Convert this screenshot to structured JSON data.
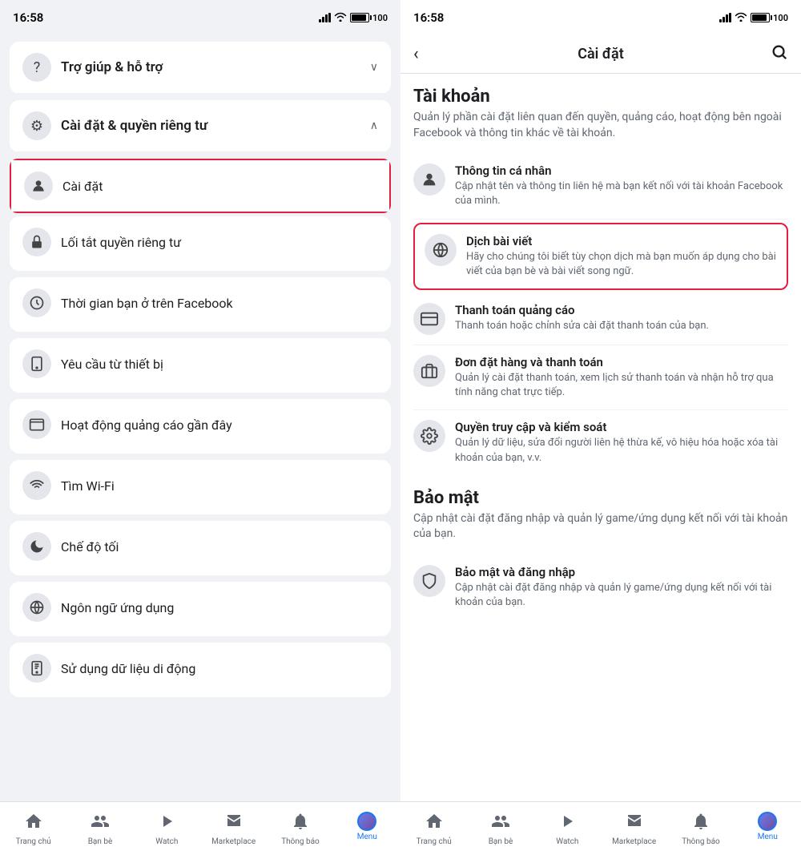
{
  "left": {
    "status_time": "16:58",
    "help_section": {
      "icon": "?",
      "label": "Trợ giúp & hỗ trợ",
      "arrow": "∨"
    },
    "settings_section": {
      "icon": "⚙",
      "label": "Cài đặt & quyền riêng tư",
      "arrow": "∧"
    },
    "highlighted_item": {
      "icon": "👤",
      "label": "Cài đặt"
    },
    "settings_items": [
      {
        "icon": "🔒",
        "label": "Lối tắt quyền riêng tư"
      },
      {
        "icon": "⏰",
        "label": "Thời gian bạn ở trên Facebook"
      },
      {
        "icon": "📱",
        "label": "Yêu cầu từ thiết bị"
      },
      {
        "icon": "📊",
        "label": "Hoạt động quảng cáo gần đây"
      },
      {
        "icon": "📶",
        "label": "Tìm Wi-Fi"
      },
      {
        "icon": "🌙",
        "label": "Chế độ tối"
      },
      {
        "icon": "🌐",
        "label": "Ngôn ngữ ứng dụng"
      },
      {
        "icon": "📱",
        "label": "Sử dụng dữ liệu di động"
      }
    ],
    "nav": [
      {
        "icon": "🏠",
        "label": "Trang chủ",
        "active": false
      },
      {
        "icon": "👥",
        "label": "Bạn bè",
        "active": false
      },
      {
        "icon": "▶",
        "label": "Watch",
        "active": false
      },
      {
        "icon": "🏪",
        "label": "Marketplace",
        "active": false
      },
      {
        "icon": "🔔",
        "label": "Thông báo",
        "active": false
      },
      {
        "icon": "☰",
        "label": "Menu",
        "active": true
      }
    ]
  },
  "right": {
    "status_time": "16:58",
    "header": {
      "title": "Cài đặt",
      "back": "‹",
      "search": "🔍"
    },
    "account_section": {
      "title": "Tài khoản",
      "desc": "Quản lý phần cài đặt liên quan đến quyền, quảng cáo, hoạt động bên ngoài Facebook và thông tin khác về tài khoản.",
      "items": [
        {
          "icon": "👤",
          "title": "Thông tin cá nhân",
          "desc": "Cập nhật tên và thông tin liên hệ mà bạn kết nối với tài khoản Facebook của mình.",
          "highlighted": false
        },
        {
          "icon": "🌐",
          "title": "Dịch bài viết",
          "desc": "Hãy cho chúng tôi biết tùy chọn dịch mà bạn muốn áp dụng cho bài viết của bạn bè và bài viết song ngữ.",
          "highlighted": true
        },
        {
          "icon": "💳",
          "title": "Thanh toán quảng cáo",
          "desc": "Thanh toán hoặc chỉnh sửa cài đặt thanh toán của bạn.",
          "highlighted": false
        },
        {
          "icon": "📦",
          "title": "Đơn đặt hàng và thanh toán",
          "desc": "Quản lý cài đặt thanh toán, xem lịch sử thanh toán và nhận hỗ trợ qua tính năng chat trực tiếp.",
          "highlighted": false
        },
        {
          "icon": "⚙",
          "title": "Quyền truy cập và kiểm soát",
          "desc": "Quản lý dữ liệu, sửa đổi người liên hệ thừa kế, vô hiệu hóa hoặc xóa tài khoản của bạn, v.v.",
          "highlighted": false
        }
      ]
    },
    "security_section": {
      "title": "Bảo mật",
      "desc": "Cập nhật cài đặt đăng nhập và quản lý game/ứng dụng kết nối với tài khoản của bạn.",
      "items": [
        {
          "icon": "🛡",
          "title": "Bảo mật và đăng nhập",
          "desc": "Cập nhật cài đặt đăng nhập và quản lý game/ứng dụng kết nối với tài khoản của bạn.",
          "highlighted": false
        }
      ]
    },
    "nav": [
      {
        "icon": "🏠",
        "label": "Trang chủ",
        "active": false
      },
      {
        "icon": "👥",
        "label": "Bạn bè",
        "active": false
      },
      {
        "icon": "▶",
        "label": "Watch",
        "active": false
      },
      {
        "icon": "🏪",
        "label": "Marketplace",
        "active": false
      },
      {
        "icon": "🔔",
        "label": "Thông báo",
        "active": false
      },
      {
        "icon": "☰",
        "label": "Menu",
        "active": true
      }
    ]
  }
}
